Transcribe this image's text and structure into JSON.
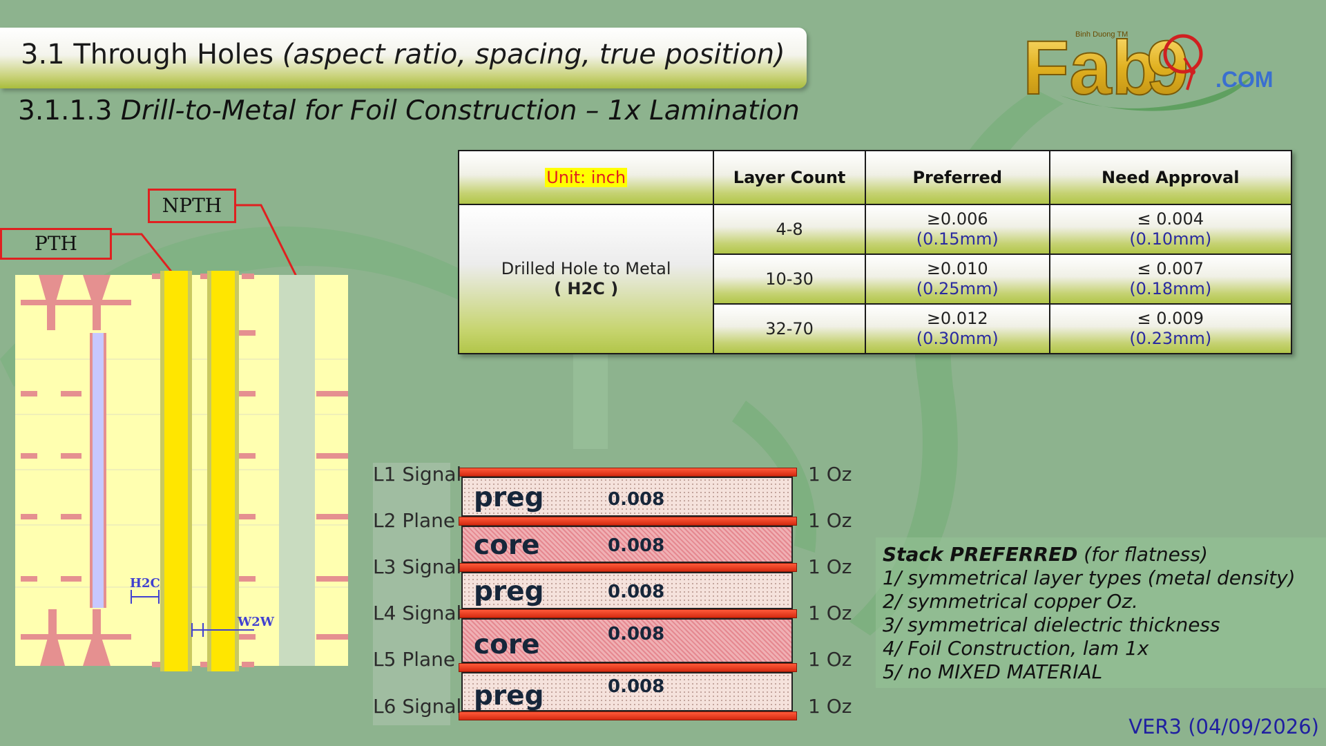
{
  "slide": {
    "title": "3.1 Through Holes",
    "title_paren": "(aspect ratio, spacing, true position)",
    "subtitle_num": "3.1.1.3",
    "subtitle_text": "Drill-to-Metal for Foil Construction – 1x Lamination",
    "version": "VER3 (04/09/2026)"
  },
  "logo": {
    "text": "Fab9",
    "small_text": "Binh Duong TM",
    "domain": ".COM"
  },
  "table": {
    "unit": "Unit: inch",
    "headers": [
      "Layer Count",
      "Preferred",
      "Need Approval"
    ],
    "param_name": "Drilled Hole to Metal",
    "param_code": "( H2C )",
    "rows": [
      {
        "layers": "4-8",
        "pref": "≥0.006",
        "pref_mm": "(0.15mm)",
        "appr": "≤ 0.004",
        "appr_mm": "(0.10mm)"
      },
      {
        "layers": "10-30",
        "pref": "≥0.010",
        "pref_mm": "(0.25mm)",
        "appr": "≤ 0.007",
        "appr_mm": "(0.18mm)"
      },
      {
        "layers": "32-70",
        "pref": "≥0.012",
        "pref_mm": "(0.30mm)",
        "appr": "≤ 0.009",
        "appr_mm": "(0.23mm)"
      }
    ]
  },
  "pcb": {
    "labels": {
      "pth": "PTH",
      "npth": "NPTH",
      "h2c": "H2C",
      "w2w": "W2W"
    },
    "colors": {
      "board": "#ffffb0",
      "barrel": "#ffe600",
      "pad": "#e59090",
      "via_fill": "#c7c8ff",
      "npth": "#c9dcc0"
    }
  },
  "stack": {
    "layers": [
      {
        "name": "L1 Signal",
        "oz": "1 Oz"
      },
      {
        "name": "L2 Plane",
        "oz": "1 Oz"
      },
      {
        "name": "L3 Signal",
        "oz": "1 Oz"
      },
      {
        "name": "L4 Signal",
        "oz": "1 Oz"
      },
      {
        "name": "L5 Plane",
        "oz": "1 Oz"
      },
      {
        "name": "L6 Signal",
        "oz": "1 Oz"
      }
    ],
    "dielectrics": [
      {
        "type": "preg",
        "thk": "0.008"
      },
      {
        "type": "core",
        "thk": "0.008"
      },
      {
        "type": "preg",
        "thk": "0.008"
      },
      {
        "type": "core",
        "thk": "0.008"
      },
      {
        "type": "preg",
        "thk": "0.008"
      }
    ]
  },
  "notes": {
    "title_bold": "Stack PREFERRED",
    "title_rest": "(for flatness)",
    "items": [
      "1/ symmetrical layer types (metal density)",
      "2/ symmetrical copper Oz.",
      "3/ symmetrical dielectric thickness",
      "4/ Foil Construction, lam 1x",
      "5/ no MIXED MATERIAL"
    ]
  }
}
